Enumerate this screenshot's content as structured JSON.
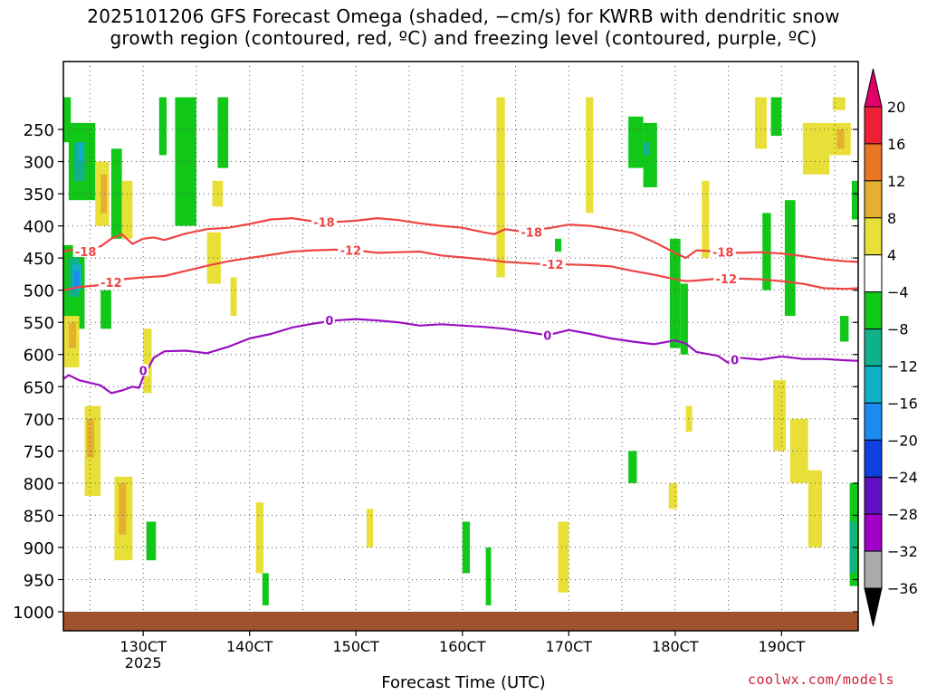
{
  "title_line1": "2025101206 GFS Forecast Omega (shaded, −cm/s) for KWRB with dendritic snow",
  "title_line2": "growth region (contoured, red, ºC) and freezing level (contoured, purple, ºC)",
  "credit": "coolwx.com/models",
  "chart_data": {
    "type": "heatmap",
    "xlabel": "Forecast Time (UTC)",
    "x_ticks": [
      {
        "label": "130CT",
        "sub": "2025",
        "t": 130
      },
      {
        "label": "140CT",
        "sub": "",
        "t": 140
      },
      {
        "label": "150CT",
        "sub": "",
        "t": 150
      },
      {
        "label": "160CT",
        "sub": "",
        "t": 160
      },
      {
        "label": "170CT",
        "sub": "",
        "t": 170
      },
      {
        "label": "180CT",
        "sub": "",
        "t": 180
      },
      {
        "label": "190CT",
        "sub": "",
        "t": 190
      }
    ],
    "xlim": [
      122.5,
      197.2
    ],
    "y_ticks": [
      "250",
      "300",
      "350",
      "400",
      "450",
      "500",
      "550",
      "600",
      "650",
      "700",
      "750",
      "800",
      "850",
      "900",
      "950",
      "1000"
    ],
    "ylim": [
      200,
      1020
    ],
    "grid": true,
    "colorbar": {
      "labels": [
        "20",
        "16",
        "12",
        "8",
        "4",
        "−4",
        "−8",
        "−12",
        "−16",
        "−20",
        "−24",
        "−28",
        "−32",
        "−36"
      ],
      "colors": [
        "#ee2035",
        "#ea7522",
        "#e5b02f",
        "#e8e038",
        "#ffffff",
        "#11c818",
        "#10b08a",
        "#10b0c8",
        "#1a8cf0",
        "#1040e0",
        "#6010c0",
        "#a000c8",
        "#aaaaaa"
      ],
      "top_color": "#e0006a",
      "bottom_color": "#000000"
    },
    "ground_color": "#a0522d",
    "contours": [
      {
        "name": "dgz -18",
        "color": "#ef4444",
        "label": "-18",
        "points": [
          [
            122.5,
            440
          ],
          [
            124,
            435
          ],
          [
            126,
            432
          ],
          [
            127,
            420
          ],
          [
            128,
            413
          ],
          [
            129,
            428
          ],
          [
            130,
            420
          ],
          [
            131,
            418
          ],
          [
            132,
            422
          ],
          [
            134,
            412
          ],
          [
            136,
            405
          ],
          [
            138,
            403
          ],
          [
            140,
            397
          ],
          [
            142,
            390
          ],
          [
            144,
            388
          ],
          [
            146,
            393
          ],
          [
            148,
            394
          ],
          [
            150,
            392
          ],
          [
            152,
            388
          ],
          [
            154,
            391
          ],
          [
            156,
            396
          ],
          [
            158,
            400
          ],
          [
            160,
            403
          ],
          [
            162,
            410
          ],
          [
            163,
            413
          ],
          [
            164,
            405
          ],
          [
            166,
            410
          ],
          [
            167,
            405
          ],
          [
            168,
            404
          ],
          [
            170,
            398
          ],
          [
            172,
            400
          ],
          [
            174,
            405
          ],
          [
            176,
            411
          ],
          [
            178,
            425
          ],
          [
            180,
            442
          ],
          [
            181,
            450
          ],
          [
            182,
            438
          ],
          [
            184,
            440
          ],
          [
            186,
            442
          ],
          [
            188,
            441
          ],
          [
            190,
            443
          ],
          [
            192,
            447
          ],
          [
            194,
            452
          ],
          [
            196,
            455
          ],
          [
            197.2,
            456
          ]
        ],
        "label_points": [
          [
            124.6,
            440
          ],
          [
            147,
            394
          ],
          [
            166.5,
            410
          ],
          [
            184.5,
            441
          ]
        ]
      },
      {
        "name": "dgz -12",
        "color": "#ef4444",
        "label": "-12",
        "points": [
          [
            122.5,
            500
          ],
          [
            124,
            495
          ],
          [
            126,
            492
          ],
          [
            128,
            483
          ],
          [
            130,
            480
          ],
          [
            132,
            478
          ],
          [
            134,
            470
          ],
          [
            136,
            462
          ],
          [
            138,
            455
          ],
          [
            140,
            450
          ],
          [
            142,
            445
          ],
          [
            144,
            440
          ],
          [
            146,
            438
          ],
          [
            148,
            437
          ],
          [
            150,
            438
          ],
          [
            152,
            442
          ],
          [
            154,
            441
          ],
          [
            156,
            440
          ],
          [
            158,
            446
          ],
          [
            160,
            449
          ],
          [
            162,
            452
          ],
          [
            164,
            456
          ],
          [
            166,
            458
          ],
          [
            168,
            460
          ],
          [
            170,
            460
          ],
          [
            172,
            461
          ],
          [
            174,
            463
          ],
          [
            176,
            470
          ],
          [
            178,
            476
          ],
          [
            180,
            483
          ],
          [
            181,
            486
          ],
          [
            182,
            485
          ],
          [
            184,
            482
          ],
          [
            186,
            482
          ],
          [
            188,
            483
          ],
          [
            190,
            486
          ],
          [
            192,
            490
          ],
          [
            194,
            497
          ],
          [
            196,
            498
          ],
          [
            197.2,
            497
          ]
        ],
        "label_points": [
          [
            127,
            488
          ],
          [
            149.5,
            438
          ],
          [
            168.5,
            460
          ],
          [
            184.8,
            482
          ]
        ]
      },
      {
        "name": "freezing level 0",
        "color": "#9910c0",
        "label": "0",
        "points": [
          [
            122.5,
            638
          ],
          [
            123,
            632
          ],
          [
            124,
            640
          ],
          [
            126,
            648
          ],
          [
            127,
            660
          ],
          [
            128,
            656
          ],
          [
            129,
            650
          ],
          [
            129.6,
            652
          ],
          [
            130,
            635
          ],
          [
            131,
            605
          ],
          [
            132,
            595
          ],
          [
            134,
            594
          ],
          [
            136,
            598
          ],
          [
            138,
            588
          ],
          [
            140,
            575
          ],
          [
            142,
            568
          ],
          [
            144,
            558
          ],
          [
            146,
            552
          ],
          [
            148,
            547
          ],
          [
            150,
            545
          ],
          [
            152,
            547
          ],
          [
            154,
            550
          ],
          [
            156,
            555
          ],
          [
            158,
            553
          ],
          [
            160,
            555
          ],
          [
            162,
            557
          ],
          [
            164,
            560
          ],
          [
            166,
            565
          ],
          [
            168,
            570
          ],
          [
            170,
            562
          ],
          [
            172,
            568
          ],
          [
            174,
            575
          ],
          [
            176,
            580
          ],
          [
            178,
            584
          ],
          [
            180,
            578
          ],
          [
            181,
            583
          ],
          [
            182,
            596
          ],
          [
            184,
            602
          ],
          [
            185,
            613
          ],
          [
            186,
            605
          ],
          [
            188,
            608
          ],
          [
            190,
            603
          ],
          [
            192,
            607
          ],
          [
            194,
            607
          ],
          [
            196,
            609
          ],
          [
            197.2,
            610
          ]
        ],
        "label_points": [
          [
            130,
            625
          ],
          [
            147.5,
            547
          ],
          [
            168,
            570
          ],
          [
            185.6,
            608
          ]
        ]
      }
    ],
    "omega_cells": [
      {
        "t0": 122.5,
        "t1": 124.5,
        "p0": 430,
        "p1": 560,
        "c": "#11c818"
      },
      {
        "t0": 123,
        "t1": 124,
        "p0": 450,
        "p1": 510,
        "c": "#10b08a"
      },
      {
        "t0": 123.4,
        "t1": 124.2,
        "p0": 460,
        "p1": 500,
        "c": "#10b0c8"
      },
      {
        "t0": 123.5,
        "t1": 124,
        "p0": 470,
        "p1": 495,
        "c": "#1a8cf0"
      },
      {
        "t0": 122.5,
        "t1": 123.2,
        "p0": 200,
        "p1": 270,
        "c": "#11c818"
      },
      {
        "t0": 123,
        "t1": 125.5,
        "p0": 240,
        "p1": 360,
        "c": "#11c818"
      },
      {
        "t0": 123.5,
        "t1": 124.5,
        "p0": 270,
        "p1": 330,
        "c": "#10b08a"
      },
      {
        "t0": 123.9,
        "t1": 124.4,
        "p0": 270,
        "p1": 300,
        "c": "#10b0c8"
      },
      {
        "t0": 125.5,
        "t1": 126.8,
        "p0": 300,
        "p1": 400,
        "c": "#e8e038"
      },
      {
        "t0": 126,
        "t1": 126.6,
        "p0": 320,
        "p1": 380,
        "c": "#e5b02f"
      },
      {
        "t0": 127,
        "t1": 128,
        "p0": 280,
        "p1": 420,
        "c": "#11c818"
      },
      {
        "t0": 128,
        "t1": 129,
        "p0": 330,
        "p1": 420,
        "c": "#e8e038"
      },
      {
        "t0": 122.5,
        "t1": 124,
        "p0": 540,
        "p1": 620,
        "c": "#e8e038"
      },
      {
        "t0": 123,
        "t1": 123.7,
        "p0": 550,
        "p1": 590,
        "c": "#e5b02f"
      },
      {
        "t0": 126,
        "t1": 127,
        "p0": 500,
        "p1": 560,
        "c": "#11c818"
      },
      {
        "t0": 124.5,
        "t1": 126,
        "p0": 680,
        "p1": 820,
        "c": "#e8e038"
      },
      {
        "t0": 124.7,
        "t1": 125.4,
        "p0": 700,
        "p1": 760,
        "c": "#e5b02f"
      },
      {
        "t0": 127.3,
        "t1": 129,
        "p0": 790,
        "p1": 920,
        "c": "#e8e038"
      },
      {
        "t0": 127.7,
        "t1": 128.4,
        "p0": 800,
        "p1": 880,
        "c": "#e5b02f"
      },
      {
        "t0": 130,
        "t1": 130.8,
        "p0": 560,
        "p1": 660,
        "c": "#e8e038"
      },
      {
        "t0": 130.3,
        "t1": 131.2,
        "p0": 860,
        "p1": 920,
        "c": "#11c818"
      },
      {
        "t0": 131.5,
        "t1": 132.2,
        "p0": 200,
        "p1": 290,
        "c": "#11c818"
      },
      {
        "t0": 133,
        "t1": 135,
        "p0": 200,
        "p1": 400,
        "c": "#11c818"
      },
      {
        "t0": 136,
        "t1": 137.3,
        "p0": 410,
        "p1": 490,
        "c": "#e8e038"
      },
      {
        "t0": 136.5,
        "t1": 137.5,
        "p0": 330,
        "p1": 370,
        "c": "#e8e038"
      },
      {
        "t0": 137,
        "t1": 138,
        "p0": 200,
        "p1": 310,
        "c": "#11c818"
      },
      {
        "t0": 138.2,
        "t1": 138.8,
        "p0": 480,
        "p1": 540,
        "c": "#e8e038"
      },
      {
        "t0": 140.6,
        "t1": 141.3,
        "p0": 830,
        "p1": 940,
        "c": "#e8e038"
      },
      {
        "t0": 141.2,
        "t1": 141.8,
        "p0": 940,
        "p1": 990,
        "c": "#11c818"
      },
      {
        "t0": 151,
        "t1": 151.6,
        "p0": 840,
        "p1": 900,
        "c": "#e8e038"
      },
      {
        "t0": 160,
        "t1": 160.7,
        "p0": 860,
        "p1": 940,
        "c": "#11c818"
      },
      {
        "t0": 162.2,
        "t1": 162.7,
        "p0": 900,
        "p1": 990,
        "c": "#11c818"
      },
      {
        "t0": 163.2,
        "t1": 164,
        "p0": 200,
        "p1": 480,
        "c": "#e8e038"
      },
      {
        "t0": 169,
        "t1": 170,
        "p0": 860,
        "p1": 970,
        "c": "#e8e038"
      },
      {
        "t0": 168.7,
        "t1": 169.3,
        "p0": 420,
        "p1": 440,
        "c": "#11c818"
      },
      {
        "t0": 171.6,
        "t1": 172.3,
        "p0": 200,
        "p1": 380,
        "c": "#e8e038"
      },
      {
        "t0": 175.6,
        "t1": 177,
        "p0": 230,
        "p1": 310,
        "c": "#11c818"
      },
      {
        "t0": 177,
        "t1": 178.3,
        "p0": 240,
        "p1": 340,
        "c": "#11c818"
      },
      {
        "t0": 177,
        "t1": 177.6,
        "p0": 270,
        "p1": 290,
        "c": "#10b08a"
      },
      {
        "t0": 175.6,
        "t1": 176.4,
        "p0": 750,
        "p1": 800,
        "c": "#11c818"
      },
      {
        "t0": 179.5,
        "t1": 180.5,
        "p0": 420,
        "p1": 590,
        "c": "#11c818"
      },
      {
        "t0": 180.5,
        "t1": 181.2,
        "p0": 490,
        "p1": 600,
        "c": "#11c818"
      },
      {
        "t0": 181,
        "t1": 181.6,
        "p0": 680,
        "p1": 720,
        "c": "#e8e038"
      },
      {
        "t0": 179.4,
        "t1": 180.2,
        "p0": 800,
        "p1": 840,
        "c": "#e8e038"
      },
      {
        "t0": 182.5,
        "t1": 183.2,
        "p0": 330,
        "p1": 450,
        "c": "#e8e038"
      },
      {
        "t0": 187.5,
        "t1": 188.6,
        "p0": 200,
        "p1": 280,
        "c": "#e8e038"
      },
      {
        "t0": 189,
        "t1": 190,
        "p0": 200,
        "p1": 260,
        "c": "#11c818"
      },
      {
        "t0": 188.2,
        "t1": 189,
        "p0": 380,
        "p1": 500,
        "c": "#11c818"
      },
      {
        "t0": 190.3,
        "t1": 191.3,
        "p0": 360,
        "p1": 540,
        "c": "#11c818"
      },
      {
        "t0": 189.2,
        "t1": 190.4,
        "p0": 640,
        "p1": 750,
        "c": "#e8e038"
      },
      {
        "t0": 190.8,
        "t1": 192.5,
        "p0": 700,
        "p1": 800,
        "c": "#e8e038"
      },
      {
        "t0": 192.5,
        "t1": 193.8,
        "p0": 780,
        "p1": 900,
        "c": "#e8e038"
      },
      {
        "t0": 192,
        "t1": 193,
        "p0": 240,
        "p1": 260,
        "c": "#e8e038"
      },
      {
        "t0": 192,
        "t1": 194.5,
        "p0": 240,
        "p1": 320,
        "c": "#e8e038"
      },
      {
        "t0": 194.5,
        "t1": 196.5,
        "p0": 240,
        "p1": 290,
        "c": "#e8e038"
      },
      {
        "t0": 195.2,
        "t1": 195.9,
        "p0": 250,
        "p1": 280,
        "c": "#e5b02f"
      },
      {
        "t0": 194.8,
        "t1": 196,
        "p0": 200,
        "p1": 220,
        "c": "#e8e038"
      },
      {
        "t0": 195.5,
        "t1": 196.3,
        "p0": 540,
        "p1": 580,
        "c": "#11c818"
      },
      {
        "t0": 196.6,
        "t1": 197.2,
        "p0": 330,
        "p1": 390,
        "c": "#11c818"
      },
      {
        "t0": 196.4,
        "t1": 197.2,
        "p0": 800,
        "p1": 960,
        "c": "#11c818"
      },
      {
        "t0": 196.4,
        "t1": 197,
        "p0": 860,
        "p1": 940,
        "c": "#10b08a"
      }
    ]
  }
}
